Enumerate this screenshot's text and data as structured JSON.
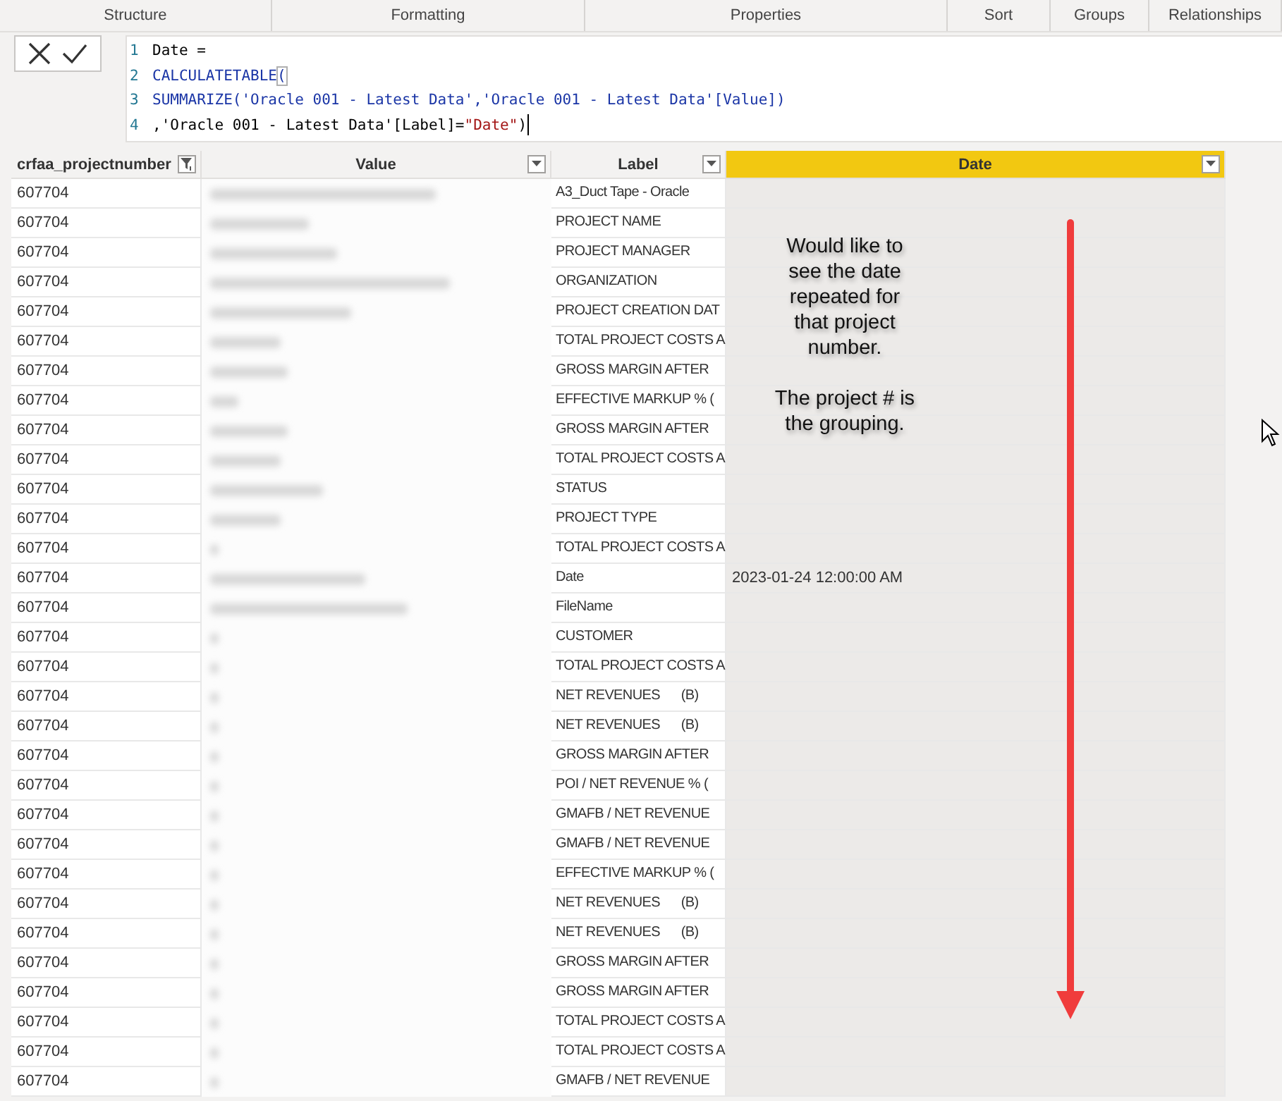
{
  "ribbon": {
    "groups": [
      "Structure",
      "Formatting",
      "Properties",
      "Sort",
      "Groups",
      "Relationships"
    ]
  },
  "formula_bar": {
    "lines": [
      {
        "number": "1",
        "tokens": [
          {
            "kind": "plain",
            "text": "Date ="
          }
        ]
      },
      {
        "number": "2",
        "tokens": [
          {
            "kind": "function",
            "text": "CALCULATETABLE"
          },
          {
            "kind": "bracket",
            "text": "("
          }
        ]
      },
      {
        "number": "3",
        "tokens": [
          {
            "kind": "function",
            "text": "SUMMARIZE('Oracle 001 - Latest Data','Oracle 001 - Latest Data'[Value])"
          }
        ]
      },
      {
        "number": "4",
        "tokens": [
          {
            "kind": "plain",
            "text": ",'Oracle 001 - Latest Data'[Label]="
          },
          {
            "kind": "string",
            "text": "\"Date\""
          },
          {
            "kind": "plain",
            "text": ")"
          }
        ]
      }
    ]
  },
  "table": {
    "columns": [
      {
        "name": "crfaa_projectnumber",
        "selected": false,
        "filtered": true
      },
      {
        "name": "Value",
        "selected": false,
        "filtered": false
      },
      {
        "name": "Label",
        "selected": false,
        "filtered": false
      },
      {
        "name": "Date",
        "selected": true,
        "filtered": false
      }
    ],
    "rows": [
      {
        "project": "607704",
        "label": "A3_Duct Tape - Oracle"
      },
      {
        "project": "607704",
        "label": "PROJECT NAME"
      },
      {
        "project": "607704",
        "label": "PROJECT MANAGER"
      },
      {
        "project": "607704",
        "label": "ORGANIZATION"
      },
      {
        "project": "607704",
        "label": "PROJECT CREATION DAT"
      },
      {
        "project": "607704",
        "label": "TOTAL PROJECT COSTS A"
      },
      {
        "project": "607704",
        "label": "GROSS MARGIN AFTER"
      },
      {
        "project": "607704",
        "label": "EFFECTIVE MARKUP % ("
      },
      {
        "project": "607704",
        "label": "GROSS MARGIN AFTER"
      },
      {
        "project": "607704",
        "label": "TOTAL PROJECT COSTS A"
      },
      {
        "project": "607704",
        "label": "STATUS"
      },
      {
        "project": "607704",
        "label": "PROJECT TYPE"
      },
      {
        "project": "607704",
        "label": "TOTAL PROJECT COSTS A"
      },
      {
        "project": "607704",
        "label": "Date",
        "date": "2023-01-24 12:00:00 AM"
      },
      {
        "project": "607704",
        "label": "FileName"
      },
      {
        "project": "607704",
        "label": "CUSTOMER"
      },
      {
        "project": "607704",
        "label": "TOTAL PROJECT COSTS A"
      },
      {
        "project": "607704",
        "label": "NET REVENUES      (B)"
      },
      {
        "project": "607704",
        "label": "NET REVENUES      (B)"
      },
      {
        "project": "607704",
        "label": "GROSS MARGIN AFTER"
      },
      {
        "project": "607704",
        "label": "POI / NET REVENUE % ("
      },
      {
        "project": "607704",
        "label": "GMAFB / NET REVENUE"
      },
      {
        "project": "607704",
        "label": "GMAFB / NET REVENUE"
      },
      {
        "project": "607704",
        "label": "EFFECTIVE MARKUP % ("
      },
      {
        "project": "607704",
        "label": "NET REVENUES      (B)"
      },
      {
        "project": "607704",
        "label": "NET REVENUES      (B)"
      },
      {
        "project": "607704",
        "label": "GROSS MARGIN AFTER"
      },
      {
        "project": "607704",
        "label": "GROSS MARGIN AFTER"
      },
      {
        "project": "607704",
        "label": "TOTAL PROJECT COSTS A"
      },
      {
        "project": "607704",
        "label": "TOTAL PROJECT COSTS A"
      },
      {
        "project": "607704",
        "label": "GMAFB / NET REVENUE"
      }
    ]
  },
  "annotation": {
    "paragraphs": [
      "Would like to see the date repeated for that project number.",
      "The project # is the grouping."
    ]
  }
}
